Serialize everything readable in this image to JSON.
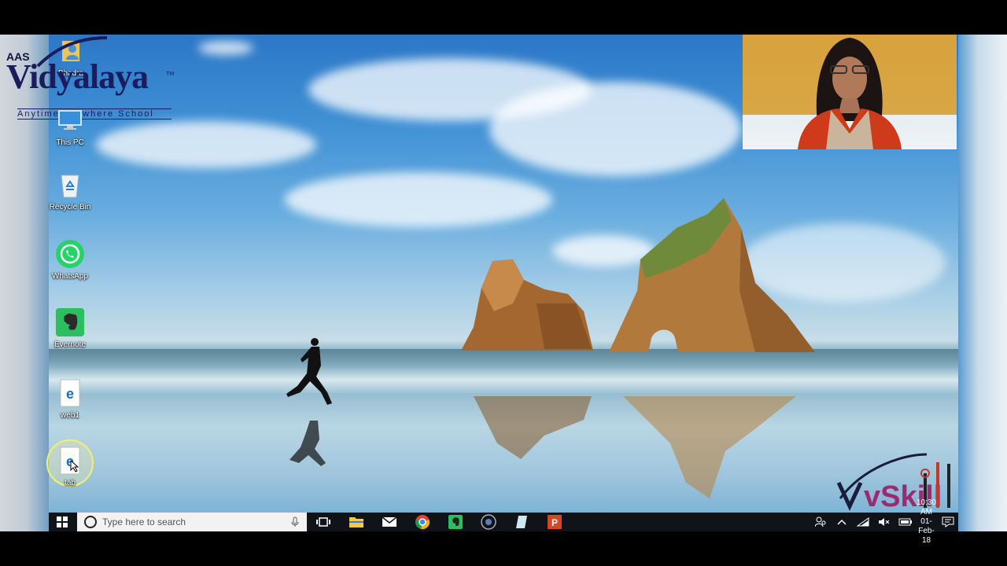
{
  "logo": {
    "prefix": "AAS",
    "name": "Vidyalaya",
    "trademark": "TM",
    "tagline": "Anytime Anywhere School"
  },
  "desktop_icons": [
    {
      "label": "Bhadra",
      "icon": "user-folder-icon"
    },
    {
      "label": "This PC",
      "icon": "computer-icon"
    },
    {
      "label": "Recycle Bin",
      "icon": "recycle-bin-icon"
    },
    {
      "label": "WhatsApp",
      "icon": "whatsapp-icon"
    },
    {
      "label": "Evernote",
      "icon": "evernote-icon"
    },
    {
      "label": "web1",
      "icon": "edge-document-icon"
    },
    {
      "label": "tab",
      "icon": "edge-document-icon"
    }
  ],
  "taskbar": {
    "search_placeholder": "Type here to search",
    "pinned_apps": [
      "task-view-icon",
      "file-explorer-icon",
      "mail-icon",
      "chrome-icon",
      "evernote-icon",
      "media-icon",
      "sticky-notes-icon",
      "powerpoint-icon"
    ],
    "tray_icons": [
      "people-icon",
      "chevron-up-icon",
      "wifi-icon",
      "mute-icon",
      "battery-icon"
    ],
    "time": "10:30 AM",
    "date": "01-Feb-18"
  },
  "watermark": {
    "brand": "vSkill"
  },
  "colors": {
    "taskbar": "#101418",
    "logo_navy": "#1b1b5e",
    "selection_ring": "#f6ef6a",
    "whatsapp": "#25d366",
    "evernote": "#2dbe60",
    "powerpoint": "#d24726"
  }
}
